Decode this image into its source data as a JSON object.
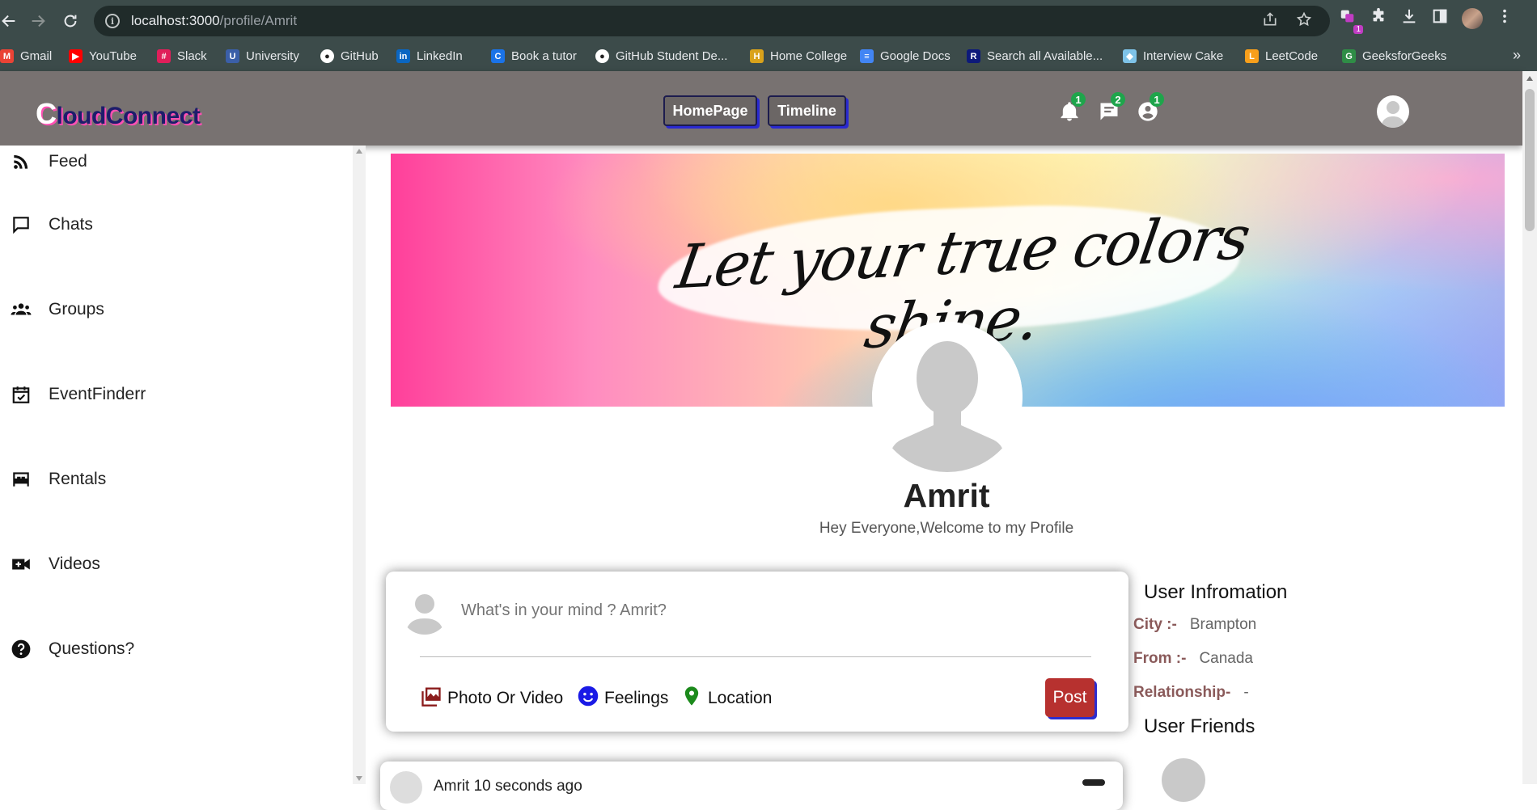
{
  "browser": {
    "url_host": "localhost:3000",
    "url_path": "/profile/Amrit",
    "extension_badge": "1",
    "bookmarks": [
      {
        "label": "Gmail",
        "icon": "gmail-icon",
        "color": "#ea4335"
      },
      {
        "label": "YouTube",
        "icon": "youtube-icon",
        "color": "#ff0000"
      },
      {
        "label": "Slack",
        "icon": "slack-icon",
        "color": "#e01e5a"
      },
      {
        "label": "University",
        "icon": "university-icon",
        "color": "#3b5fa8"
      },
      {
        "label": "GitHub",
        "icon": "github-icon",
        "color": "#ffffff"
      },
      {
        "label": "LinkedIn",
        "icon": "linkedin-icon",
        "color": "#0a66c2"
      },
      {
        "label": "Book a tutor",
        "icon": "tutor-icon",
        "color": "#1a73e8"
      },
      {
        "label": "GitHub Student De...",
        "icon": "github-icon",
        "color": "#ffffff"
      },
      {
        "label": "Home College",
        "icon": "college-icon",
        "color": "#d9a21b"
      },
      {
        "label": "Google Docs",
        "icon": "google-docs-icon",
        "color": "#4285f4"
      },
      {
        "label": "Search all Available...",
        "icon": "search-portal-icon",
        "color": "#0d1a7a"
      },
      {
        "label": "Interview Cake",
        "icon": "interview-cake-icon",
        "color": "#7ec3e8"
      },
      {
        "label": "LeetCode",
        "icon": "leetcode-icon",
        "color": "#f89f1b"
      },
      {
        "label": "GeeksforGeeks",
        "icon": "geeksforgeeks-icon",
        "color": "#2f8d46"
      }
    ]
  },
  "header": {
    "logo_initial": "C",
    "logo_rest": "loudConnect",
    "nav": {
      "homepage": "HomePage",
      "timeline": "Timeline"
    },
    "badges": {
      "notifications": "1",
      "messages": "2",
      "friend_requests": "1"
    }
  },
  "sidebar": {
    "items": [
      {
        "label": "Feed",
        "icon": "rss-feed-icon"
      },
      {
        "label": "Chats",
        "icon": "chat-icon"
      },
      {
        "label": "Groups",
        "icon": "groups-icon"
      },
      {
        "label": "EventFinderr",
        "icon": "calendar-check-icon"
      },
      {
        "label": "Rentals",
        "icon": "bed-icon"
      },
      {
        "label": "Videos",
        "icon": "video-camera-icon"
      },
      {
        "label": "Questions?",
        "icon": "help-icon"
      }
    ]
  },
  "profile": {
    "cover_text": "Let your true colors shine.",
    "name": "Amrit",
    "description": "Hey Everyone,Welcome to my Profile"
  },
  "share": {
    "placeholder": "What's in your mind ? Amrit?",
    "options": {
      "photo": "Photo Or Video",
      "feelings": "Feelings",
      "location": "Location"
    },
    "post_label": "Post",
    "colors": {
      "photo": "#8b1c1c",
      "feelings": "#1a1ae6",
      "location": "#1c8a1c",
      "post": "#b7312f"
    }
  },
  "user_info": {
    "title": "User Infromation",
    "city_label": "City :-",
    "city_value": "Brampton",
    "from_label": "From :-",
    "from_value": "Canada",
    "relationship_label": "Relationship-",
    "relationship_value": "-"
  },
  "friends": {
    "title": "User Friends"
  },
  "next_post": {
    "author_preview": "Amrit  10 seconds ago"
  }
}
